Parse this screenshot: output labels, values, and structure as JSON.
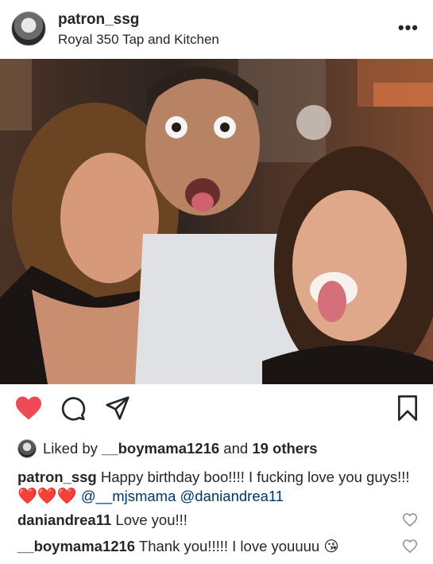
{
  "post": {
    "username": "patron_ssg",
    "location": "Royal 350 Tap and Kitchen",
    "more_icon": "more-options-icon"
  },
  "actions": {
    "like_icon": "heart-filled-icon",
    "comment_icon": "comment-icon",
    "share_icon": "direct-share-icon",
    "save_icon": "bookmark-icon",
    "like_color": "#ed4956"
  },
  "likes": {
    "prefix": "Liked by",
    "user": "__boymama1216",
    "middle": "and",
    "others": "19 others"
  },
  "caption": {
    "username": "patron_ssg",
    "text": "Happy birthday boo!!!! I fucking love you guys!!!",
    "emoji": "❤️❤️❤️",
    "mentions": [
      "@__mjsmama",
      "@daniandrea11"
    ]
  },
  "comments": [
    {
      "username": "daniandrea11",
      "text": "Love you!!!"
    },
    {
      "username": "__boymama1216",
      "text": "Thank you!!!!! I love youuuu",
      "emoji": "😘"
    }
  ]
}
